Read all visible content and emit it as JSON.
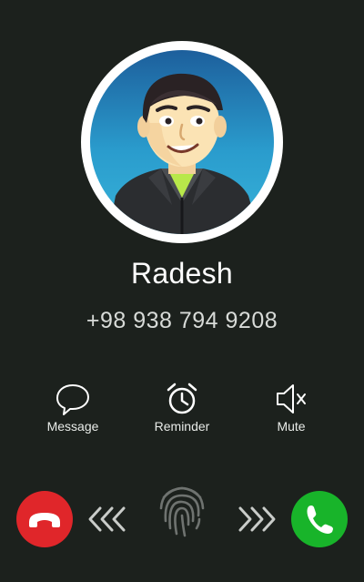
{
  "caller": {
    "name": "Radesh",
    "number": "+98 938 794 9208"
  },
  "actions": [
    {
      "label": "Message",
      "icon": "chat-bubble-icon"
    },
    {
      "label": "Reminder",
      "icon": "alarm-clock-icon"
    },
    {
      "label": "Mute",
      "icon": "speaker-mute-icon"
    }
  ],
  "controls": {
    "decline_icon": "phone-hangup-icon",
    "answer_icon": "phone-icon",
    "slider_icon": "fingerprint-icon"
  },
  "colors": {
    "background": "#1c211d",
    "decline": "#e0262a",
    "answer": "#18b42a",
    "avatar_background": "#2a8fc4"
  }
}
